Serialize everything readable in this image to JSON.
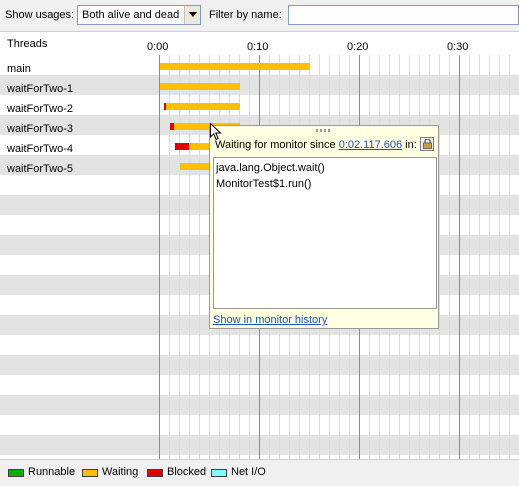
{
  "toolbar": {
    "show_usages_label": "Show usages:",
    "show_usages_value": "Both alive and dead",
    "filter_label": "Filter by name:",
    "filter_value": ""
  },
  "timeline": {
    "threads_header": "Threads",
    "ticks": [
      "0:00",
      "0:10",
      "0:20",
      "0:30"
    ],
    "threads": [
      {
        "name": "main"
      },
      {
        "name": "waitForTwo-1"
      },
      {
        "name": "waitForTwo-2"
      },
      {
        "name": "waitForTwo-3"
      },
      {
        "name": "waitForTwo-4"
      },
      {
        "name": "waitForTwo-5"
      }
    ]
  },
  "popup": {
    "header_prefix": "Waiting for monitor since ",
    "header_time": "0:02.117.606",
    "header_suffix": " in:",
    "stack": [
      "java.lang.Object.wait()",
      "MonitorTest$1.run()"
    ],
    "footer_link": "Show in monitor history"
  },
  "legend": [
    {
      "label": "Runnable",
      "color": "#00b000"
    },
    {
      "label": "Waiting",
      "color": "#ffbf00"
    },
    {
      "label": "Blocked",
      "color": "#e00000"
    },
    {
      "label": "Net I/O",
      "color": "#80ffff"
    }
  ]
}
